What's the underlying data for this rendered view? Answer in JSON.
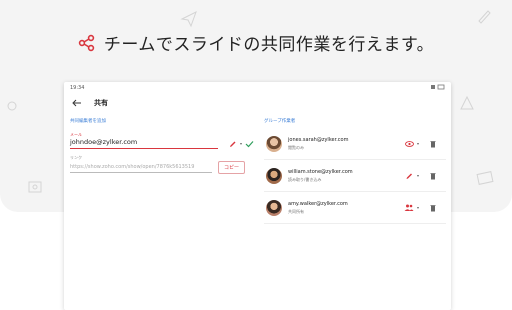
{
  "headline": "チームでスライドの共同作業を行えます。",
  "device": {
    "status_time": "19:34",
    "title": "共有",
    "left": {
      "section_label": "共同編集者を追加",
      "email_label": "メール",
      "email_value": "johndoe@zylker.com",
      "link_label": "リンク",
      "link_value": "https://show.zoho.com/show/open/7876k5613519",
      "copy_label": "コピー"
    },
    "right": {
      "section_label": "グループ作業者",
      "members": [
        {
          "email": "jones.sarah@zylker.com",
          "role": "閲覧のみ",
          "permission_icon": "eye-icon"
        },
        {
          "email": "william.stone@zylker.com",
          "role": "読み取り/書き込み",
          "permission_icon": "pencil-icon"
        },
        {
          "email": "amy.walker@zylker.com",
          "role": "共同所有",
          "permission_icon": "people-icon"
        }
      ]
    }
  },
  "colors": {
    "accent": "#d9363e",
    "link": "#3b7ed6",
    "confirm": "#2e9e5b"
  }
}
